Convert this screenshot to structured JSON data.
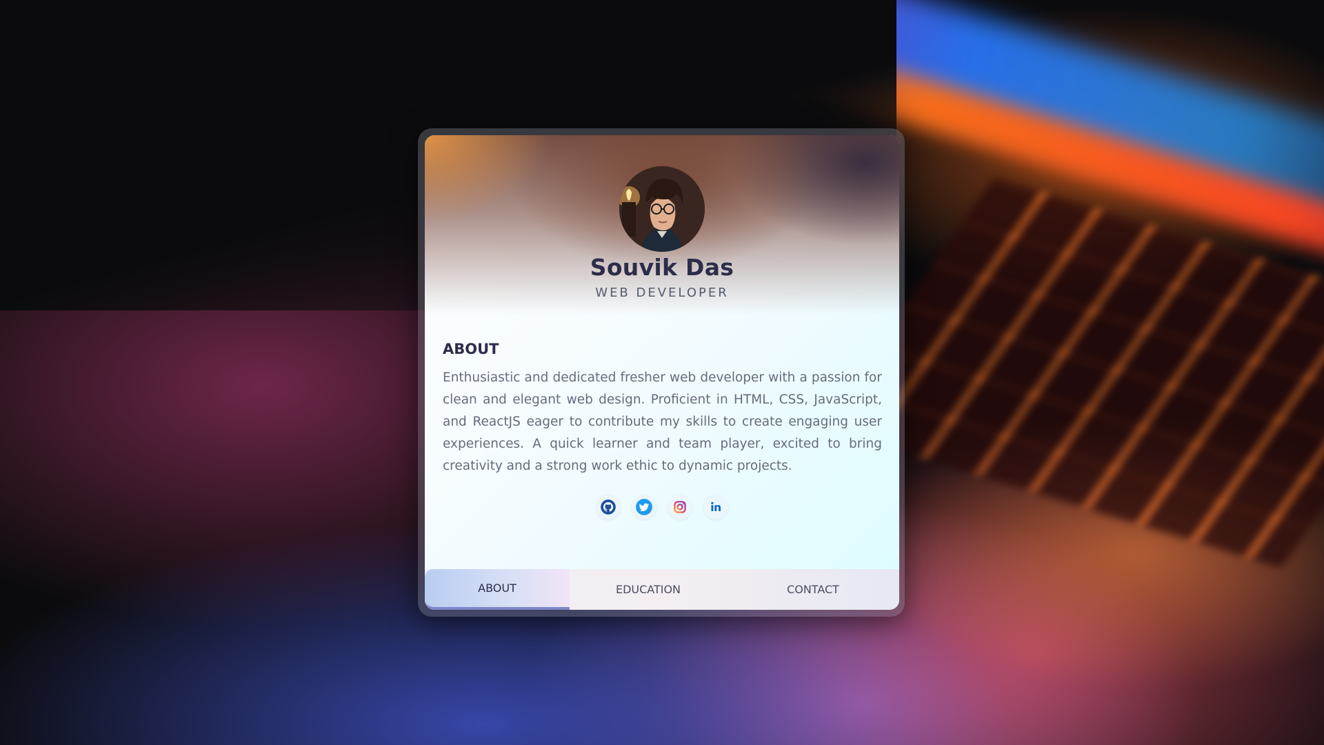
{
  "profile": {
    "name": "Souvik Das",
    "role": "WEB DEVELOPER"
  },
  "about": {
    "title": "ABOUT",
    "text": "Enthusiastic and dedicated fresher web developer with a passion for clean and elegant web design. Proficient in HTML, CSS, JavaScript, and ReactJS eager to contribute my skills to create engaging user experiences. A quick learner and team player, excited to bring creativity and a strong work ethic to dynamic projects."
  },
  "socials": [
    {
      "icon": "github-icon"
    },
    {
      "icon": "twitter-icon"
    },
    {
      "icon": "instagram-icon"
    },
    {
      "icon": "linkedin-icon"
    }
  ],
  "tabs": [
    {
      "label": "ABOUT",
      "active": true
    },
    {
      "label": "EDUCATION",
      "active": false
    },
    {
      "label": "CONTACT",
      "active": false
    }
  ],
  "colors": {
    "heading": "#2c2d4a",
    "body_text": "#676b7c",
    "active_tab_underline": "#7f86c9",
    "twitter": "#1d9bf0",
    "linkedin": "#0a66c2"
  }
}
